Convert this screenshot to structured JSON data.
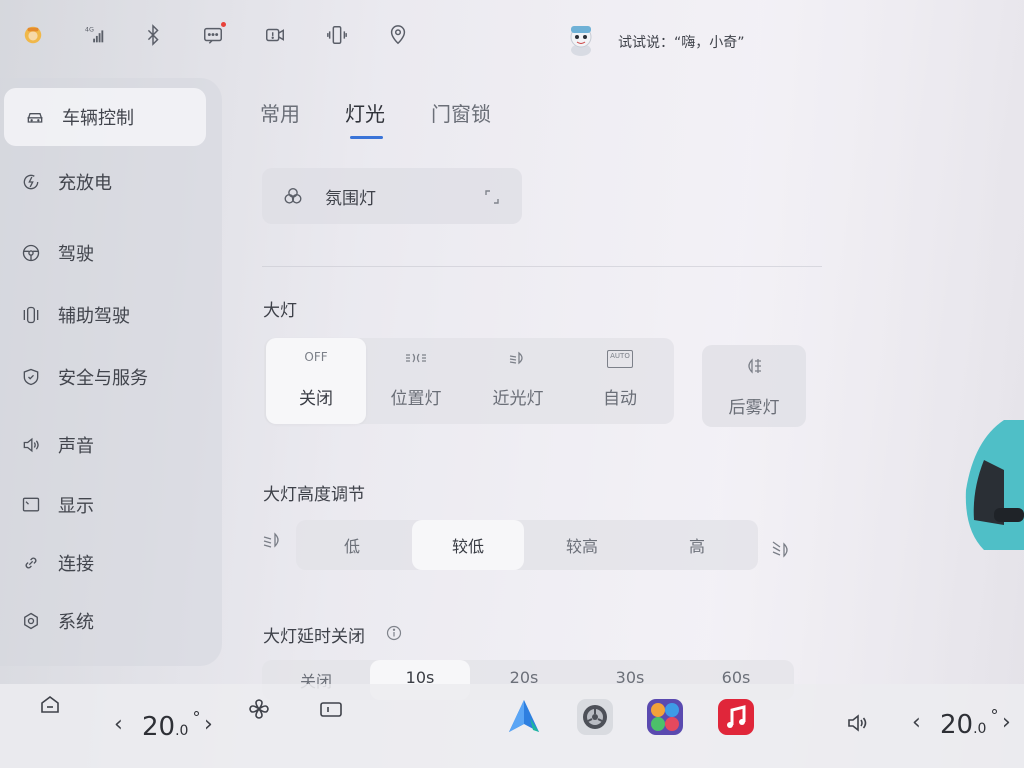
{
  "status_bar": {
    "icons": [
      "avatar-icon",
      "signal-4g-icon",
      "bluetooth-icon",
      "message-icon",
      "dashcam-icon",
      "phone-vibrate-icon",
      "location-icon"
    ],
    "signal_label": "4G",
    "assistant_hint": "试试说：“嗨，小奇”"
  },
  "sidebar": {
    "items": [
      {
        "label": "车辆控制",
        "icon": "car-icon",
        "active": true
      },
      {
        "label": "充放电",
        "icon": "charge-icon",
        "active": false
      },
      {
        "label": "驾驶",
        "icon": "steering-wheel-icon",
        "active": false
      },
      {
        "label": "辅助驾驶",
        "icon": "assist-drive-icon",
        "active": false
      },
      {
        "label": "安全与服务",
        "icon": "shield-icon",
        "active": false
      },
      {
        "label": "声音",
        "icon": "speaker-icon",
        "active": false
      },
      {
        "label": "显示",
        "icon": "display-icon",
        "active": false
      },
      {
        "label": "连接",
        "icon": "link-icon",
        "active": false
      },
      {
        "label": "系统",
        "icon": "gear-icon",
        "active": false
      }
    ]
  },
  "tabs": [
    {
      "label": "常用",
      "active": false
    },
    {
      "label": "灯光",
      "active": true
    },
    {
      "label": "门窗锁",
      "active": false
    }
  ],
  "ambient": {
    "label": "氛围灯"
  },
  "headlight": {
    "title": "大灯",
    "modes": [
      {
        "label": "关闭",
        "icon_text": "OFF",
        "active": true
      },
      {
        "label": "位置灯",
        "icon": "position-light-icon",
        "active": false
      },
      {
        "label": "近光灯",
        "icon": "low-beam-icon",
        "active": false
      },
      {
        "label": "自动",
        "icon_text": "AUTO",
        "active": false
      }
    ],
    "fog": {
      "label": "后雾灯",
      "icon": "rear-fog-icon"
    }
  },
  "height": {
    "title": "大灯高度调节",
    "options": [
      {
        "label": "低",
        "active": false
      },
      {
        "label": "较低",
        "active": true
      },
      {
        "label": "较高",
        "active": false
      },
      {
        "label": "高",
        "active": false
      }
    ]
  },
  "delay": {
    "title": "大灯延时关闭",
    "options": [
      {
        "label": "关闭",
        "active": false
      },
      {
        "label": "10s",
        "active": true
      },
      {
        "label": "20s",
        "active": false
      },
      {
        "label": "30s",
        "active": false
      },
      {
        "label": "60s",
        "active": false
      }
    ]
  },
  "dock": {
    "left_temp": {
      "int": "20",
      "dec": ".0",
      "unit": "°"
    },
    "right_temp": {
      "int": "20",
      "dec": ".0",
      "unit": "°"
    },
    "apps": [
      "navigation-app-icon",
      "settings-app-icon",
      "apps-grid-icon",
      "music-app-icon"
    ],
    "colors": {
      "nav": "#2e7fe0",
      "music": "#e0263a"
    }
  }
}
